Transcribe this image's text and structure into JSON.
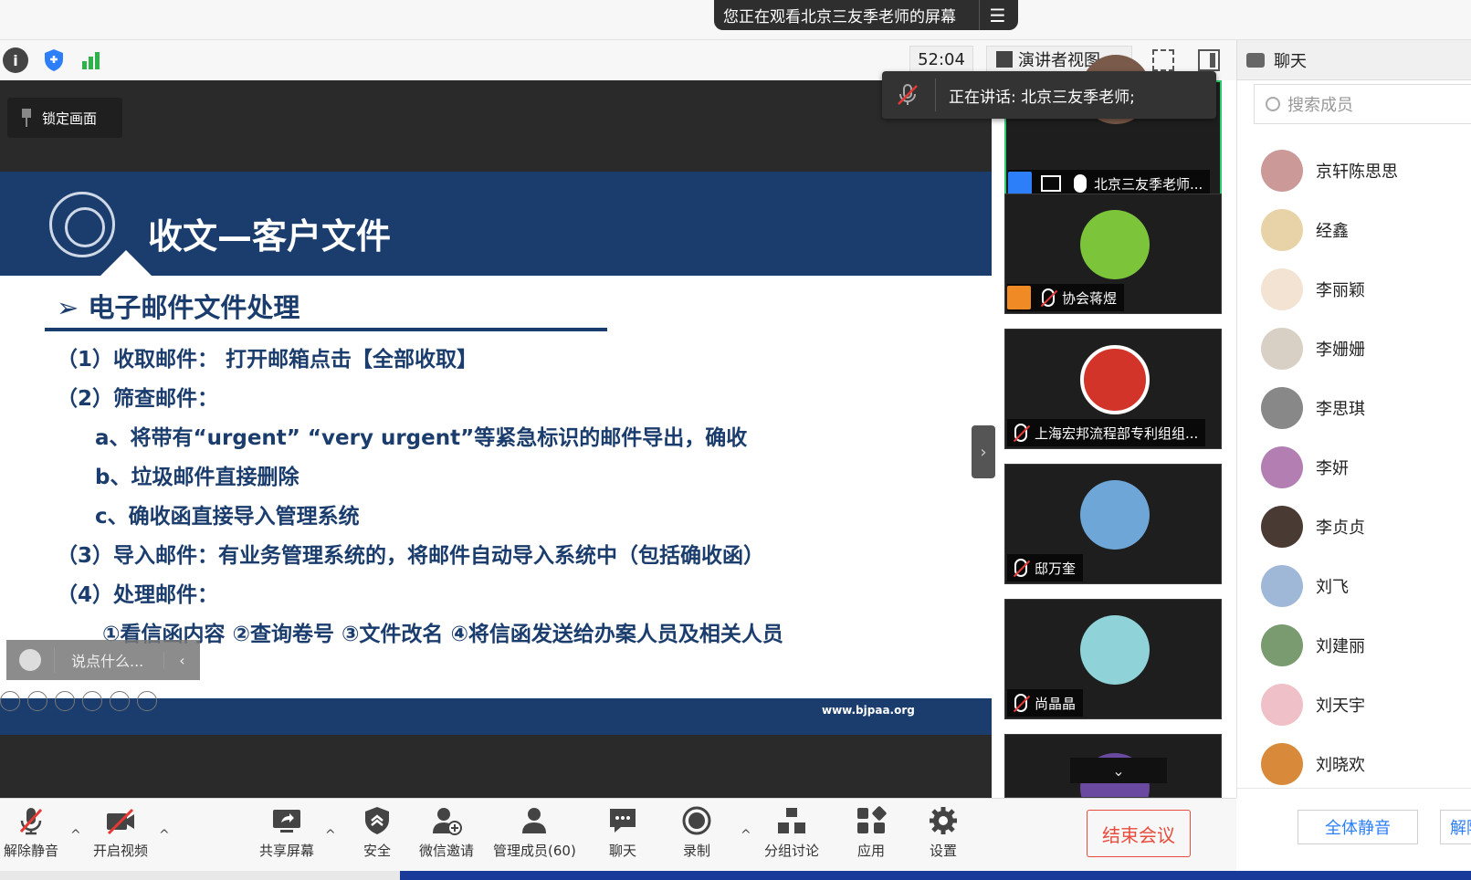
{
  "banner": {
    "share_text": "您正在观看北京三友季老师的屏幕",
    "menu_icon": "menu-icon"
  },
  "toolbar": {
    "timer": "52:04",
    "view_label": "演讲者视图"
  },
  "chat": {
    "title": "聊天"
  },
  "stage": {
    "lock_label": "锁定画面",
    "say_placeholder": "说点什么...",
    "speaking": "正在讲话: 北京三友季老师;"
  },
  "slide": {
    "title": "收文—客户文件",
    "subtitle": "电子邮件文件处理",
    "lines": [
      "（1）收取邮件：  打开邮箱点击【全部收取】",
      "（2）筛查邮件：",
      "a、将带有“urgent”  “very urgent”等紧急标识的邮件导出，确收",
      "b、垃圾邮件直接删除",
      "c、确收函直接导入管理系统",
      "（3）导入邮件：有业务管理系统的，将邮件自动导入系统中（包括确收函）",
      "（4）处理邮件：",
      "①看信函内容    ②查询卷号    ③文件改名    ④将信函发送给办案人员及相关人员"
    ],
    "footer_url": "www.bjpaa.org"
  },
  "tiles": [
    {
      "name": "北京三友季老师...",
      "color": "#7a5a4a"
    },
    {
      "name": "协会蒋煜",
      "color": "#7cc43a"
    },
    {
      "name": "上海宏邦流程部专利组组...",
      "color": "#d3342a"
    },
    {
      "name": "邸万奎",
      "color": "#6fa6d8"
    },
    {
      "name": "尚晶晶",
      "color": "#8fd3d8"
    }
  ],
  "members": {
    "search_placeholder": "搜索成员",
    "list": [
      {
        "name": "京轩陈思思",
        "color": "#c99"
      },
      {
        "name": "经鑫",
        "color": "#e8d3a8"
      },
      {
        "name": "李丽颖",
        "color": "#f3e3d3"
      },
      {
        "name": "李姗姗",
        "color": "#d8d0c4"
      },
      {
        "name": "李思琪",
        "color": "#888"
      },
      {
        "name": "李妍",
        "color": "#b37fb3"
      },
      {
        "name": "李贞贞",
        "color": "#4a3a34"
      },
      {
        "name": "刘飞",
        "color": "#9fb8d8"
      },
      {
        "name": "刘建丽",
        "color": "#7a9a70"
      },
      {
        "name": "刘天宇",
        "color": "#f0c0c8"
      },
      {
        "name": "刘晓欢",
        "color": "#d88a3a"
      }
    ],
    "mute_all": "全体静音",
    "unmute_all": "解除"
  },
  "bottom": {
    "unmute": "解除静音",
    "video": "开启视频",
    "share": "共享屏幕",
    "security": "安全",
    "wechat": "微信邀请",
    "manage": "管理成员(60)",
    "chat": "聊天",
    "record": "录制",
    "breakout": "分组讨论",
    "apps": "应用",
    "settings": "设置",
    "end": "结束会议"
  }
}
